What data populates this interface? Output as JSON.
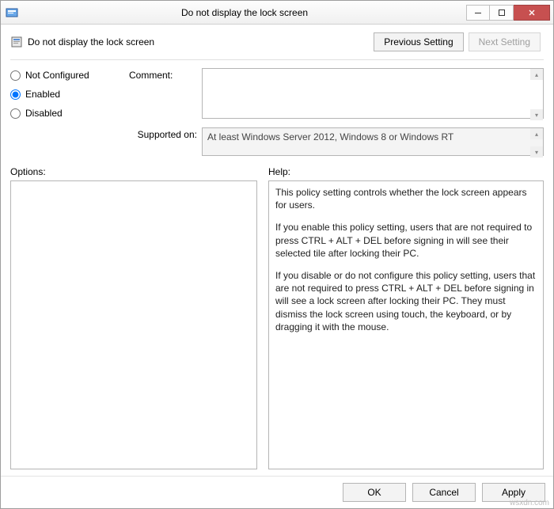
{
  "window": {
    "title": "Do not display the lock screen"
  },
  "header": {
    "policy_title": "Do not display the lock screen",
    "previous_label": "Previous Setting",
    "next_label": "Next Setting",
    "next_disabled": true
  },
  "config": {
    "radios": {
      "not_configured": "Not Configured",
      "enabled": "Enabled",
      "disabled": "Disabled",
      "selected": "enabled"
    },
    "comment_label": "Comment:",
    "comment_value": "",
    "supported_label": "Supported on:",
    "supported_value": "At least Windows Server 2012, Windows 8 or Windows RT"
  },
  "panes": {
    "options_label": "Options:",
    "help_label": "Help:",
    "help_p1": "This policy setting controls whether the lock screen appears for users.",
    "help_p2": "If you enable this policy setting, users that are not required to press CTRL + ALT + DEL before signing in will see their selected tile after  locking their PC.",
    "help_p3": "If you disable or do not configure this policy setting, users that are not required to press CTRL + ALT + DEL before signing in will see a lock screen after locking their PC. They must dismiss the lock screen using touch, the keyboard, or by dragging it with the mouse."
  },
  "footer": {
    "ok": "OK",
    "cancel": "Cancel",
    "apply": "Apply"
  },
  "watermark": "wsxdn.com"
}
